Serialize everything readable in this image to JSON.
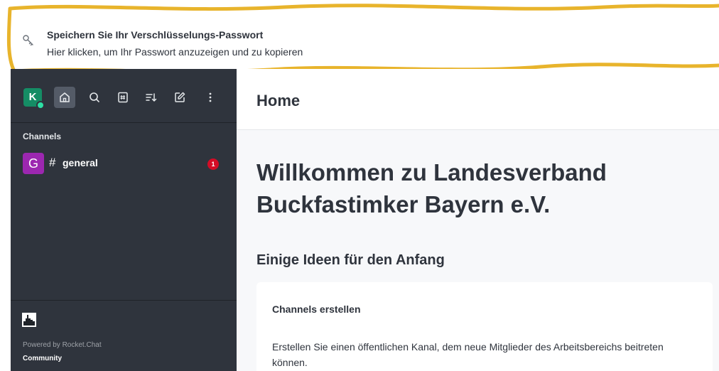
{
  "banner": {
    "icon": "key-icon",
    "title": "Speichern Sie Ihr Verschlüsselungs-Passwort",
    "subtitle": "Hier klicken, um Ihr Passwort anzuzeigen und zu kopieren",
    "highlight_color": "#e8b42c"
  },
  "sidebar": {
    "user_avatar_letter": "K",
    "status_color": "#2de0a5",
    "toolbar": [
      "home-icon",
      "search-icon",
      "directory-icon",
      "sort-icon",
      "create-new-icon",
      "kebab-menu-icon"
    ],
    "channels_label": "Channels",
    "channels": [
      {
        "avatar_letter": "G",
        "hash": "#",
        "name": "general",
        "unread": "1",
        "avatar_color": "#9c27b0"
      }
    ],
    "footer": {
      "powered_by": "Powered by Rocket.Chat",
      "community": "Community"
    }
  },
  "main": {
    "header_title": "Home",
    "welcome": "Willkommen zu Landesverband Buckfastimker Bayern e.V.",
    "ideas_title": "Einige Ideen für den Anfang",
    "card": {
      "title": "Channels erstellen",
      "text": "Erstellen Sie einen öffentlichen Kanal, dem neue Mitglieder des Arbeitsbereichs beitreten können."
    }
  }
}
